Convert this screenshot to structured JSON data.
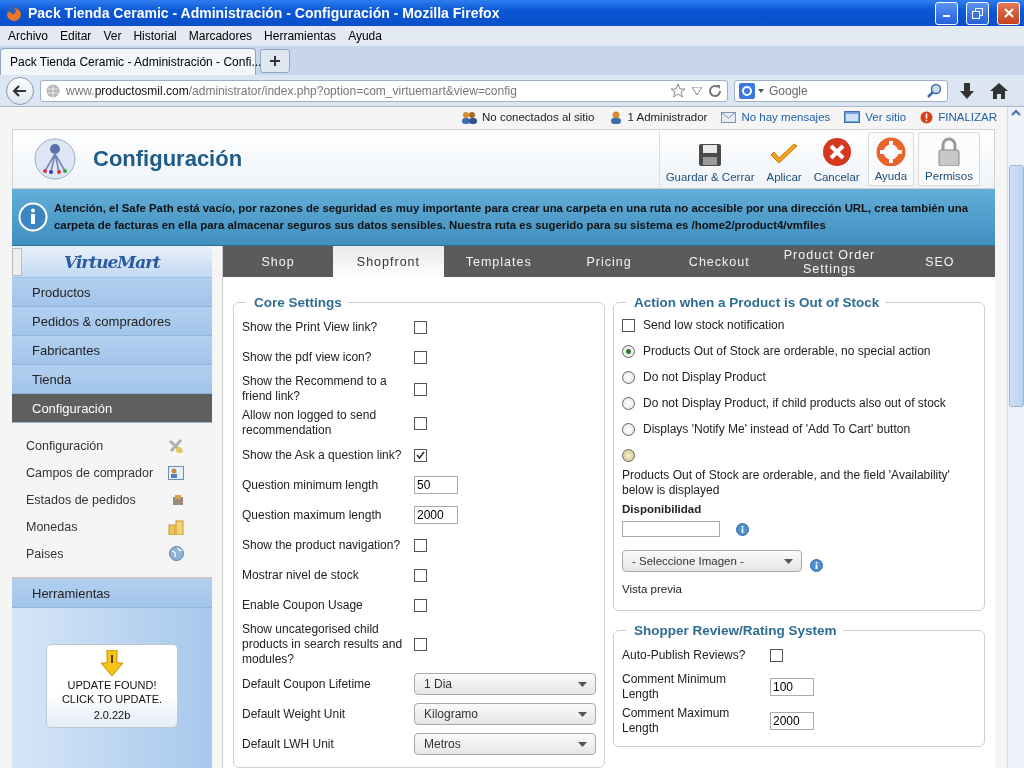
{
  "window": {
    "title": "Pack Tienda Ceramic - Administración - Configuración - Mozilla Firefox"
  },
  "menu": [
    "Archivo",
    "Editar",
    "Ver",
    "Historial",
    "Marcadores",
    "Herramientas",
    "Ayuda"
  ],
  "browser_tabs": [
    {
      "label": "Pack Tienda Ceramic - Administración - Confi...",
      "selected": true
    }
  ],
  "address": {
    "prefix": "www.",
    "domain": "productosmil.com",
    "path": "/administrator/index.php?option=com_virtuemart&view=config",
    "search_placeholder": "Google"
  },
  "status": [
    {
      "label": "No conectados al sitio",
      "kind": "text"
    },
    {
      "label": "1 Administrador",
      "kind": "text"
    },
    {
      "label": "No hay mensajes",
      "kind": "link"
    },
    {
      "label": "Ver sitio",
      "kind": "link"
    },
    {
      "label": "FINALIZAR",
      "kind": "link"
    }
  ],
  "header": {
    "title": "Configuración",
    "buttons": [
      {
        "label": "Guardar & Cerrar",
        "boxed": false
      },
      {
        "label": "Aplicar",
        "boxed": false
      },
      {
        "label": "Cancelar",
        "boxed": false
      },
      {
        "label": "Ayuda",
        "boxed": true
      },
      {
        "label": "Permisos",
        "boxed": true
      }
    ]
  },
  "notice": "Atención, el Safe Path está vacío, por razones de seguridad es muy importante para crear una carpeta en una ruta no accesible por una dirección URL, crea también una carpeta de facturas en ella para almacenar seguros sus datos sensibles. Nuestra ruta es sugerido para su sistema es /home2/product4/vmfiles",
  "sidebar": {
    "logo": "VirtueMart",
    "items": [
      {
        "label": "Productos",
        "selected": false
      },
      {
        "label": "Pedidos & compradores",
        "selected": false
      },
      {
        "label": "Fabricantes",
        "selected": false
      },
      {
        "label": "Tienda",
        "selected": false
      },
      {
        "label": "Configuración",
        "selected": true,
        "children": [
          "Configuración",
          "Campos de comprador",
          "Estados de pedidos",
          "Monedas",
          "Paises"
        ]
      },
      {
        "label": "Herramientas",
        "selected": false
      }
    ],
    "update": {
      "message": "UPDATE FOUND! CLICK TO UPDATE.",
      "version": "2.0.22b"
    }
  },
  "tabs": [
    {
      "label": "Shop",
      "selected": false
    },
    {
      "label": "Shopfront",
      "selected": true
    },
    {
      "label": "Templates",
      "selected": false
    },
    {
      "label": "Pricing",
      "selected": false
    },
    {
      "label": "Checkout",
      "selected": false
    },
    {
      "label": "Product Order Settings",
      "selected": false
    },
    {
      "label": "SEO",
      "selected": false
    }
  ],
  "core_settings": {
    "legend": "Core Settings",
    "rows": [
      {
        "kind": "checkbox",
        "label": "Show the Print View link?",
        "checked": false
      },
      {
        "kind": "checkbox",
        "label": "Show the pdf view icon?",
        "checked": false
      },
      {
        "kind": "checkbox",
        "label": "Show the Recommend to a friend link?",
        "checked": false
      },
      {
        "kind": "checkbox",
        "label": "Allow non logged to send recommendation",
        "checked": false
      },
      {
        "kind": "checkbox",
        "label": "Show the Ask a question link?",
        "checked": true
      },
      {
        "kind": "text",
        "label": "Question minimum length",
        "value": "50"
      },
      {
        "kind": "text",
        "label": "Question maximum length",
        "value": "2000"
      },
      {
        "kind": "checkbox",
        "label": "Show the product navigation?",
        "checked": false
      },
      {
        "kind": "checkbox",
        "label": "Mostrar nivel de stock",
        "checked": false
      },
      {
        "kind": "checkbox",
        "label": "Enable Coupon Usage",
        "checked": false
      },
      {
        "kind": "checkbox",
        "label": "Show uncategorised child products in search results and modules?",
        "checked": false
      },
      {
        "kind": "select",
        "label": "Default Coupon Lifetime",
        "value": "1 Dia"
      },
      {
        "kind": "select",
        "label": "Default Weight Unit",
        "value": "Kilogramo"
      },
      {
        "kind": "select",
        "label": "Default LWH Unit",
        "value": "Metros"
      }
    ]
  },
  "out_of_stock": {
    "legend": "Action when a Product is Out of Stock",
    "notify": {
      "label": "Send low stock notification",
      "checked": false
    },
    "options": [
      {
        "label": "Products Out of Stock are orderable, no special action",
        "selected": true,
        "kind": "inline"
      },
      {
        "label": "Do not Display Product",
        "selected": false,
        "kind": "inline"
      },
      {
        "label": "Do not Display Product, if child products also out of stock",
        "selected": false,
        "kind": "inline"
      },
      {
        "label": "Displays 'Notify Me' instead of 'Add To Cart' button",
        "selected": false,
        "kind": "inline"
      },
      {
        "label": "Products Out of Stock are orderable, and the field 'Availability' below is displayed",
        "selected": false,
        "kind": "below"
      }
    ],
    "availability_label": "Disponibilidad",
    "image_select": "- Seleccione Imagen -",
    "preview": "Vista previa"
  },
  "reviews": {
    "legend": "Shopper Review/Rating System",
    "rows": [
      {
        "kind": "checkbox",
        "label": "Auto-Publish Reviews?",
        "checked": false
      },
      {
        "kind": "text",
        "label": "Comment Minimum Length",
        "value": "100"
      },
      {
        "kind": "text",
        "label": "Comment Maximum Length",
        "value": "2000"
      }
    ]
  }
}
